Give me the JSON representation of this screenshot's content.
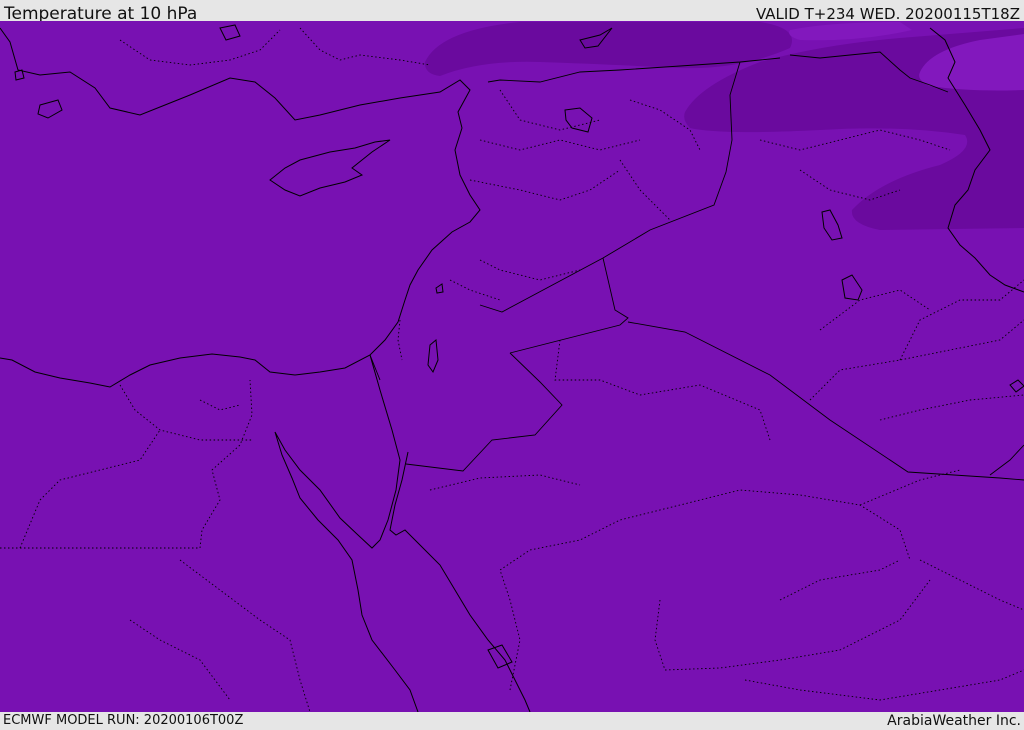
{
  "header": {
    "title": "Temperature at 10 hPa",
    "valid_time": "VALID T+234 WED. 20200115T18Z"
  },
  "footer": {
    "model_run": "ECMWF MODEL RUN: 20200106T00Z",
    "credit": "ArabiaWeather Inc."
  },
  "map": {
    "region": "Eastern Mediterranean / Middle East",
    "field_colors": {
      "base": "#7811b2",
      "cold_band": "#6a0a9e",
      "light_band": "#8519be"
    },
    "boundary_color": "#000000"
  }
}
